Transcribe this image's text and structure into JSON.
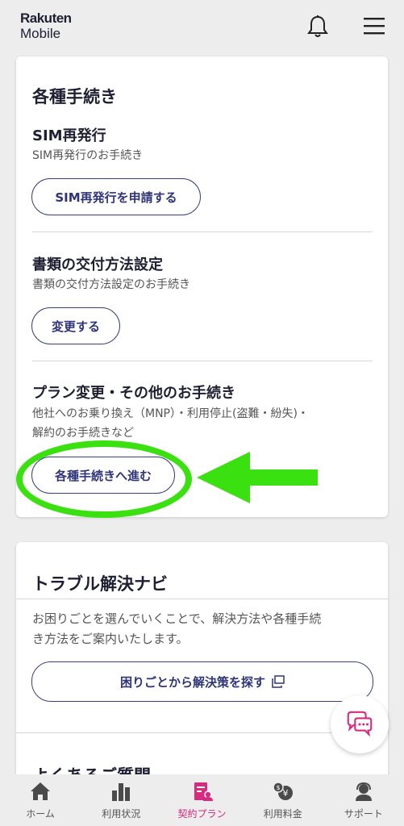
{
  "header": {
    "logo_line1": "Rakuten",
    "logo_line2": "Mobile",
    "notification_icon": "bell-icon",
    "menu_icon": "hamburger-icon"
  },
  "procedures": {
    "title": "各種手続き",
    "sim": {
      "title": "SIM再発行",
      "desc": "SIM再発行のお手続き",
      "button": "SIM再発行を申請する"
    },
    "docs": {
      "title": "書類の交付方法設定",
      "desc": "書類の交付方法設定のお手続き",
      "button": "変更する"
    },
    "plan": {
      "title": "プラン変更・その他のお手続き",
      "desc_line1": "他社へのお乗り換え（MNP）・利用停止(盗難・紛失)・",
      "desc_line2": "解約のお手続きなど",
      "button": "各種手続きへ進む"
    }
  },
  "trouble": {
    "title": "トラブル解決ナビ",
    "desc_line1": "お困りごとを選んでいくことで、解決方法や各種手続",
    "desc_line2": "き方法をご案内いたします。",
    "button": "困りごとから解決策を探す",
    "next_title_partial": "よくあるご質問"
  },
  "annotation_color": "#3ae00f",
  "brand_color": "#2f3478",
  "active_color": "#d62b7e",
  "nav": [
    {
      "label": "ホーム",
      "icon": "home-icon"
    },
    {
      "label": "利用状況",
      "icon": "bar-chart-icon"
    },
    {
      "label": "契約プラン",
      "icon": "contract-icon",
      "active": true
    },
    {
      "label": "利用料金",
      "icon": "yen-icon"
    },
    {
      "label": "サポート",
      "icon": "support-icon"
    }
  ]
}
